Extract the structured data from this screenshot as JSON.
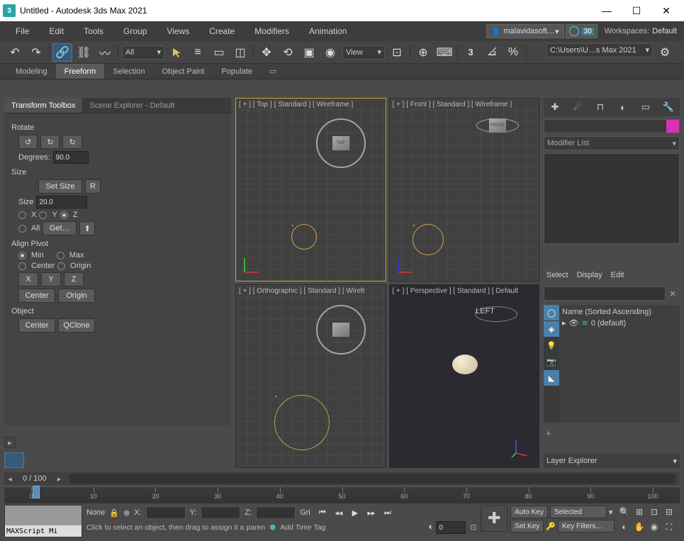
{
  "title": "Untitled - Autodesk 3ds Max 2021",
  "menu": [
    "File",
    "Edit",
    "Tools",
    "Group",
    "Views",
    "Create",
    "Modifiers",
    "Animation"
  ],
  "user": "malavidasoft…",
  "time": "30",
  "workspace_label": "Workspaces:",
  "workspace_value": "Default",
  "toolbar": {
    "all": "All",
    "view": "View",
    "path": "C:\\Users\\U…s Max 2021"
  },
  "ribbon": [
    "Modeling",
    "Freeform",
    "Selection",
    "Object Paint",
    "Populate"
  ],
  "left": {
    "tab_active": "Transform Toolbox",
    "tab_other": "Scene Explorer - Default",
    "rotate": "Rotate",
    "degrees_lbl": "Degrees:",
    "degrees_val": "90.0",
    "size": "Size",
    "set_size": "Set Size",
    "reset": "R",
    "size_lbl": "Size",
    "size_val": "20.0",
    "axis_x": "X",
    "axis_y": "Y",
    "axis_z": "Z",
    "axis_all": "All",
    "get": "Get…",
    "align": "Align Pivot",
    "min": "Min",
    "max": "Max",
    "center": "Center",
    "origin": "Origin",
    "bx": "X",
    "by": "Y",
    "bz": "Z",
    "bcenter": "Center",
    "borigin": "Origin",
    "object": "Object",
    "ocenter": "Center",
    "qclone": "QClone"
  },
  "vp": {
    "tl": "[ + ] [ Top ] [ Standard ] [ Wireframe ]",
    "tr": "[ + ] [ Front ] [ Standard ] [ Wireframe ]",
    "bl": "[ + ] [ Orthographic ] [ Standard ] [ Wirefr",
    "br": "[ + ] [ Perspective ] [ Standard ] [ Default",
    "cube_top": "TOP",
    "cube_front": "FRONT",
    "cube_left": "LEFT"
  },
  "right": {
    "modlist": "Modifier List",
    "scene_tabs": [
      "Select",
      "Display",
      "Edit"
    ],
    "name_col": "Name (Sorted Ascending)",
    "default_layer": "0 (default)",
    "layer": "Layer Explorer"
  },
  "time_disp": "0 / 100",
  "ruler_ticks": [
    "0",
    "10",
    "20",
    "30",
    "40",
    "50",
    "60",
    "70",
    "80",
    "90",
    "100"
  ],
  "bottom": {
    "script": "MAXScript Mi",
    "none": "None",
    "x": "X:",
    "y": "Y:",
    "z": "Z:",
    "grid": "Gri",
    "prompt": "Click to select an object, then drag to assign it a paren",
    "addtag": "Add Time Tag",
    "frame": "0",
    "autokey": "Auto Key",
    "setkey": "Set Key",
    "selected": "Selected",
    "keyfilters": "Key Filters…"
  }
}
